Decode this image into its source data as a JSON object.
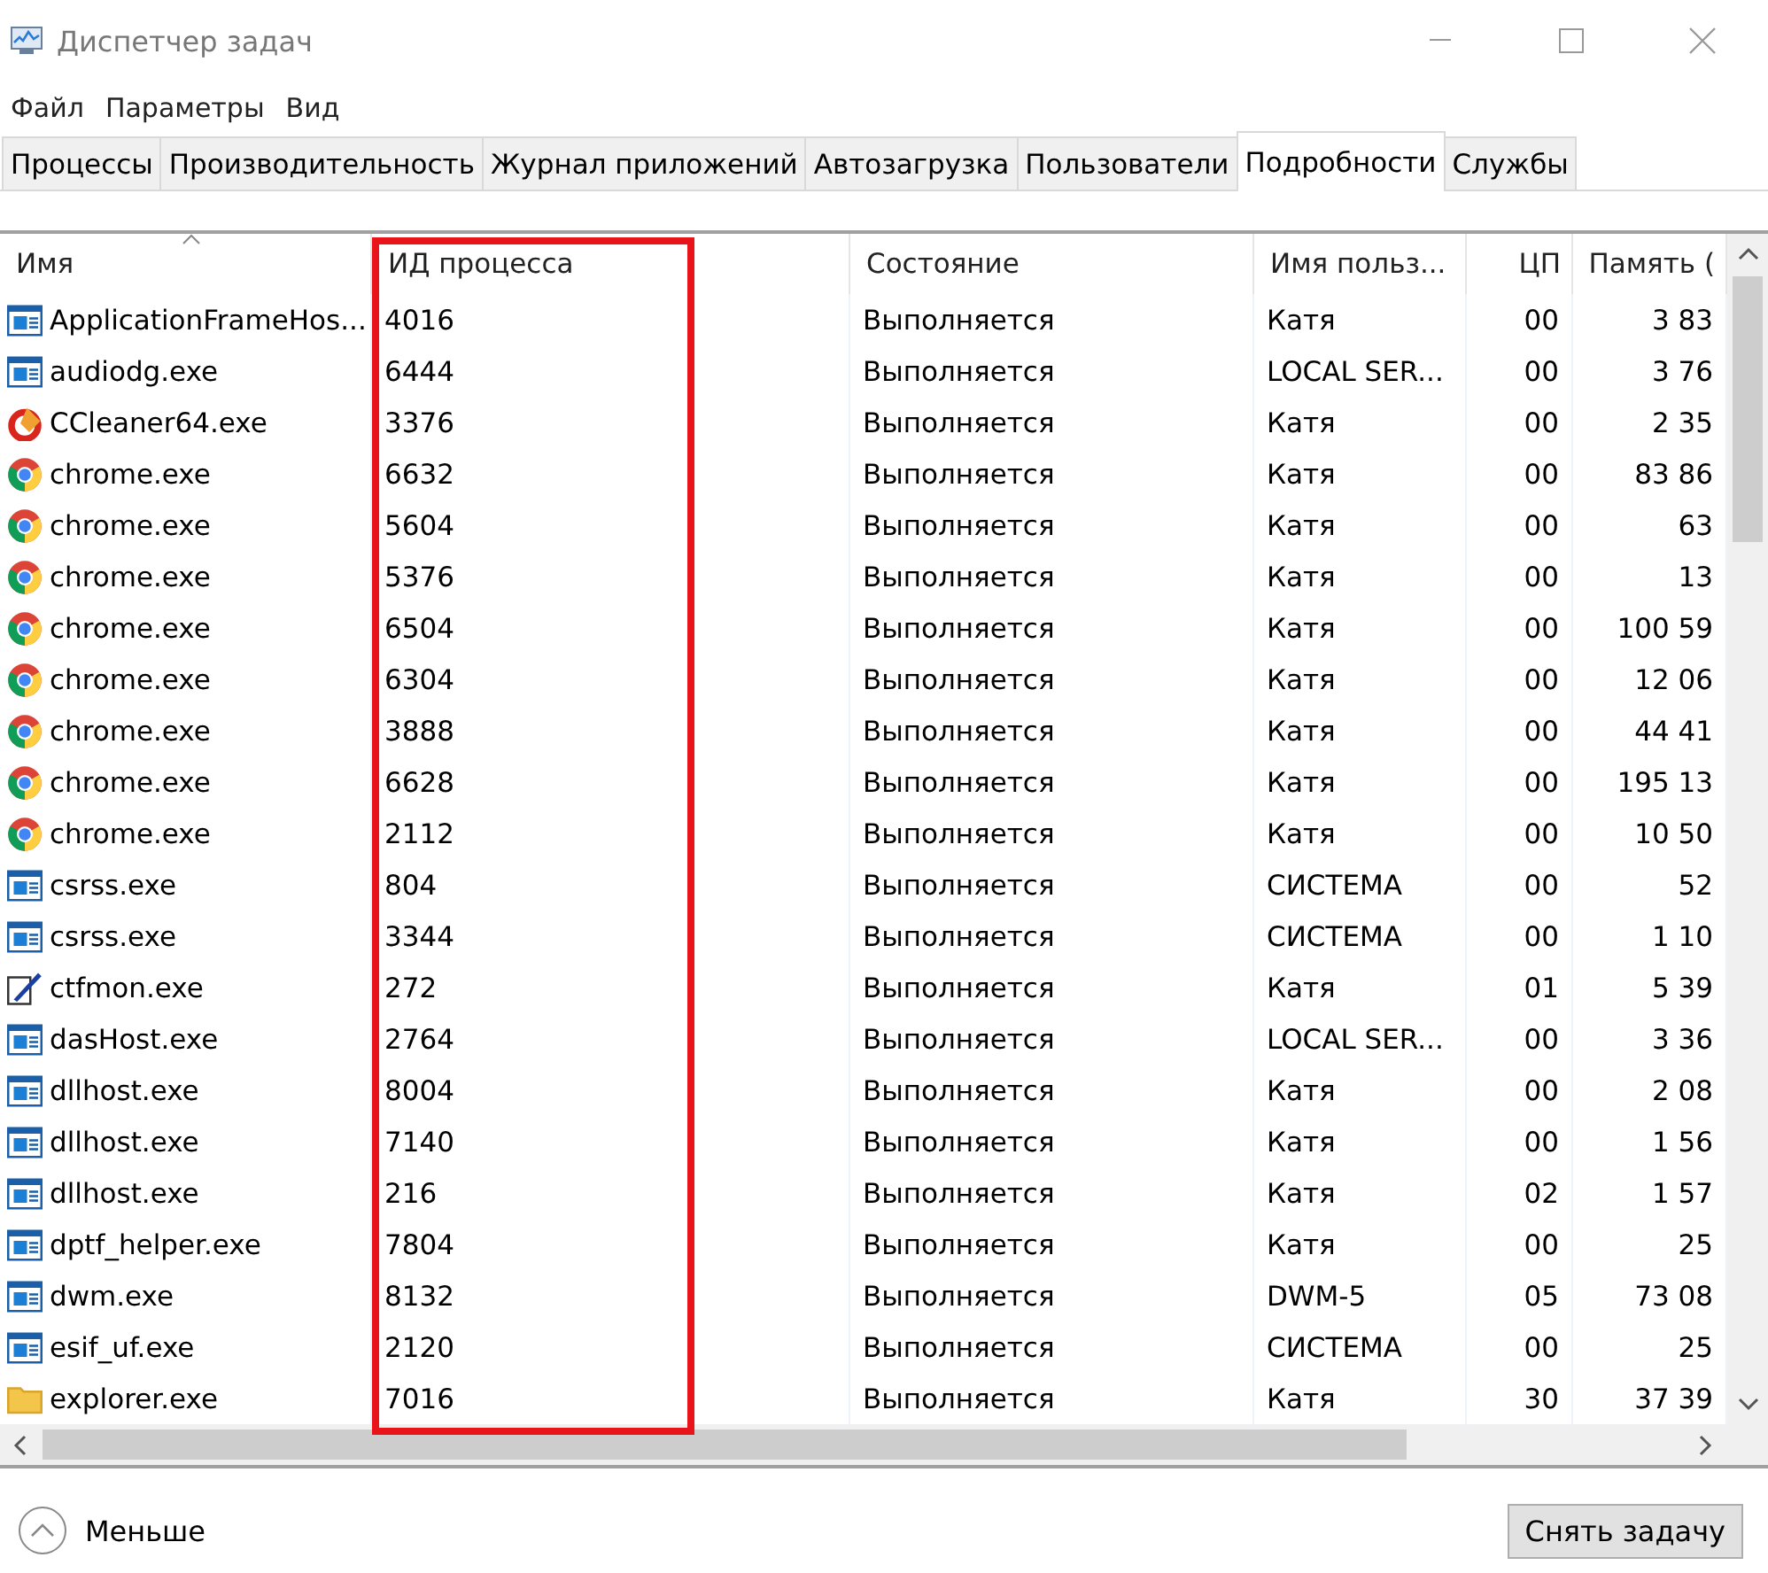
{
  "window": {
    "title": "Диспетчер задач"
  },
  "menu": [
    "Файл",
    "Параметры",
    "Вид"
  ],
  "tabs": [
    {
      "label": "Процессы",
      "selected": false
    },
    {
      "label": "Производительность",
      "selected": false
    },
    {
      "label": "Журнал приложений",
      "selected": false
    },
    {
      "label": "Автозагрузка",
      "selected": false
    },
    {
      "label": "Пользователи",
      "selected": false
    },
    {
      "label": "Подробности",
      "selected": true
    },
    {
      "label": "Службы",
      "selected": false
    }
  ],
  "table": {
    "columns": [
      {
        "label": "Имя",
        "highlighted": false
      },
      {
        "label": "ИД процесса",
        "highlighted": true
      },
      {
        "label": "Состояние",
        "highlighted": false
      },
      {
        "label": "Имя польз...",
        "highlighted": false
      },
      {
        "label": "ЦП",
        "highlighted": false
      },
      {
        "label": "Память (",
        "highlighted": false
      }
    ],
    "rows": [
      {
        "kind": "app",
        "cells": [
          "ApplicationFrameHos...",
          "4016",
          "Выполняется",
          "Катя",
          "00",
          "3 83"
        ]
      },
      {
        "kind": "app",
        "cells": [
          "audiodg.exe",
          "6444",
          "Выполняется",
          "LOCAL SER...",
          "00",
          "3 76"
        ]
      },
      {
        "kind": "ccleaner",
        "cells": [
          "CCleaner64.exe",
          "3376",
          "Выполняется",
          "Катя",
          "00",
          "2 35"
        ]
      },
      {
        "kind": "chrome",
        "cells": [
          "chrome.exe",
          "6632",
          "Выполняется",
          "Катя",
          "00",
          "83 86"
        ]
      },
      {
        "kind": "chrome",
        "cells": [
          "chrome.exe",
          "5604",
          "Выполняется",
          "Катя",
          "00",
          "63"
        ]
      },
      {
        "kind": "chrome",
        "cells": [
          "chrome.exe",
          "5376",
          "Выполняется",
          "Катя",
          "00",
          "13"
        ]
      },
      {
        "kind": "chrome",
        "cells": [
          "chrome.exe",
          "6504",
          "Выполняется",
          "Катя",
          "00",
          "100 59"
        ]
      },
      {
        "kind": "chrome",
        "cells": [
          "chrome.exe",
          "6304",
          "Выполняется",
          "Катя",
          "00",
          "12 06"
        ]
      },
      {
        "kind": "chrome",
        "cells": [
          "chrome.exe",
          "3888",
          "Выполняется",
          "Катя",
          "00",
          "44 41"
        ]
      },
      {
        "kind": "chrome",
        "cells": [
          "chrome.exe",
          "6628",
          "Выполняется",
          "Катя",
          "00",
          "195 13"
        ]
      },
      {
        "kind": "chrome",
        "cells": [
          "chrome.exe",
          "2112",
          "Выполняется",
          "Катя",
          "00",
          "10 50"
        ]
      },
      {
        "kind": "app",
        "cells": [
          "csrss.exe",
          "804",
          "Выполняется",
          "СИСТЕМА",
          "00",
          "52"
        ]
      },
      {
        "kind": "app",
        "cells": [
          "csrss.exe",
          "3344",
          "Выполняется",
          "СИСТЕМА",
          "00",
          "1 10"
        ]
      },
      {
        "kind": "pen",
        "cells": [
          "ctfmon.exe",
          "272",
          "Выполняется",
          "Катя",
          "01",
          "5 39"
        ]
      },
      {
        "kind": "app",
        "cells": [
          "dasHost.exe",
          "2764",
          "Выполняется",
          "LOCAL SER...",
          "00",
          "3 36"
        ]
      },
      {
        "kind": "app",
        "cells": [
          "dllhost.exe",
          "8004",
          "Выполняется",
          "Катя",
          "00",
          "2 08"
        ]
      },
      {
        "kind": "app",
        "cells": [
          "dllhost.exe",
          "7140",
          "Выполняется",
          "Катя",
          "00",
          "1 56"
        ]
      },
      {
        "kind": "app",
        "cells": [
          "dllhost.exe",
          "216",
          "Выполняется",
          "Катя",
          "02",
          "1 57"
        ]
      },
      {
        "kind": "app",
        "cells": [
          "dptf_helper.exe",
          "7804",
          "Выполняется",
          "Катя",
          "00",
          "25"
        ]
      },
      {
        "kind": "app",
        "cells": [
          "dwm.exe",
          "8132",
          "Выполняется",
          "DWM-5",
          "05",
          "73 08"
        ]
      },
      {
        "kind": "app",
        "cells": [
          "esif_uf.exe",
          "2120",
          "Выполняется",
          "СИСТЕМА",
          "00",
          "25"
        ]
      },
      {
        "kind": "folder",
        "cells": [
          "explorer.exe",
          "7016",
          "Выполняется",
          "Катя",
          "30",
          "37 39"
        ]
      }
    ]
  },
  "footer": {
    "less": "Меньше",
    "end_task": "Снять задачу"
  }
}
